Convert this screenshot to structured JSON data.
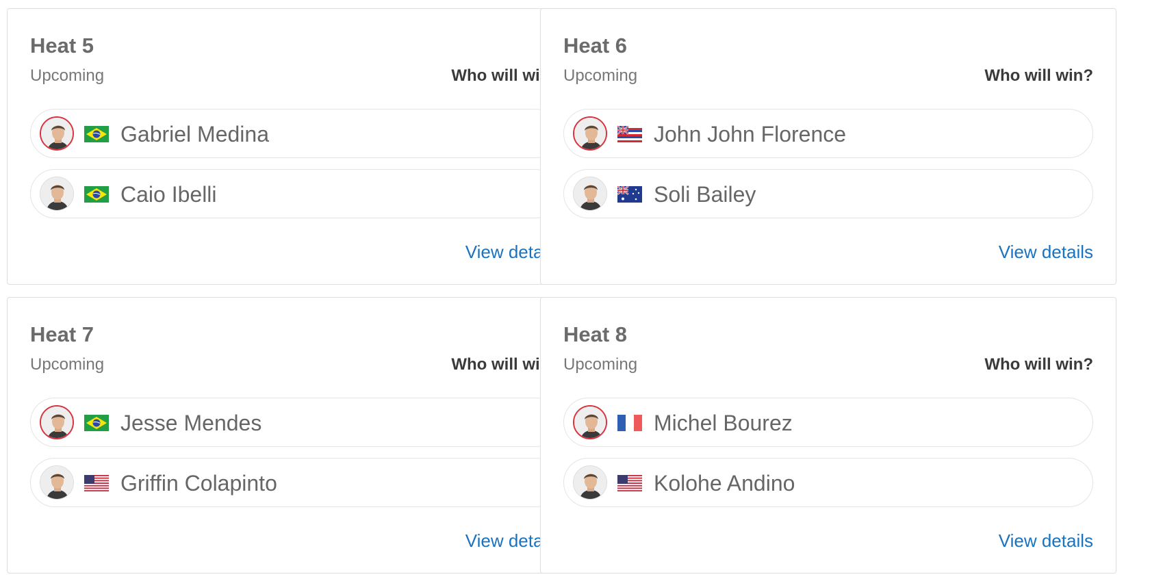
{
  "accent_color": "#1a73c0",
  "seed_ring_color": "#d9323c",
  "heats": [
    {
      "title": "Heat 5",
      "status": "Upcoming",
      "prompt": "Who will win?",
      "details_label": "View details",
      "surfers": [
        {
          "name": "Gabriel Medina",
          "flag": "brazil-flag",
          "avatar": "surfer-avatar"
        },
        {
          "name": "Caio Ibelli",
          "flag": "brazil-flag",
          "avatar": "surfer-avatar"
        }
      ]
    },
    {
      "title": "Heat 6",
      "status": "Upcoming",
      "prompt": "Who will win?",
      "details_label": "View details",
      "surfers": [
        {
          "name": "John John Florence",
          "flag": "hawaii-flag",
          "avatar": "surfer-avatar"
        },
        {
          "name": "Soli Bailey",
          "flag": "australia-flag",
          "avatar": "surfer-avatar"
        }
      ]
    },
    {
      "title": "Heat 7",
      "status": "Upcoming",
      "prompt": "Who will win?",
      "details_label": "View details",
      "surfers": [
        {
          "name": "Jesse Mendes",
          "flag": "brazil-flag",
          "avatar": "surfer-avatar"
        },
        {
          "name": "Griffin Colapinto",
          "flag": "usa-flag",
          "avatar": "surfer-avatar"
        }
      ]
    },
    {
      "title": "Heat 8",
      "status": "Upcoming",
      "prompt": "Who will win?",
      "details_label": "View details",
      "surfers": [
        {
          "name": "Michel Bourez",
          "flag": "france-flag",
          "avatar": "surfer-avatar"
        },
        {
          "name": "Kolohe Andino",
          "flag": "usa-flag",
          "avatar": "surfer-avatar"
        }
      ]
    }
  ]
}
